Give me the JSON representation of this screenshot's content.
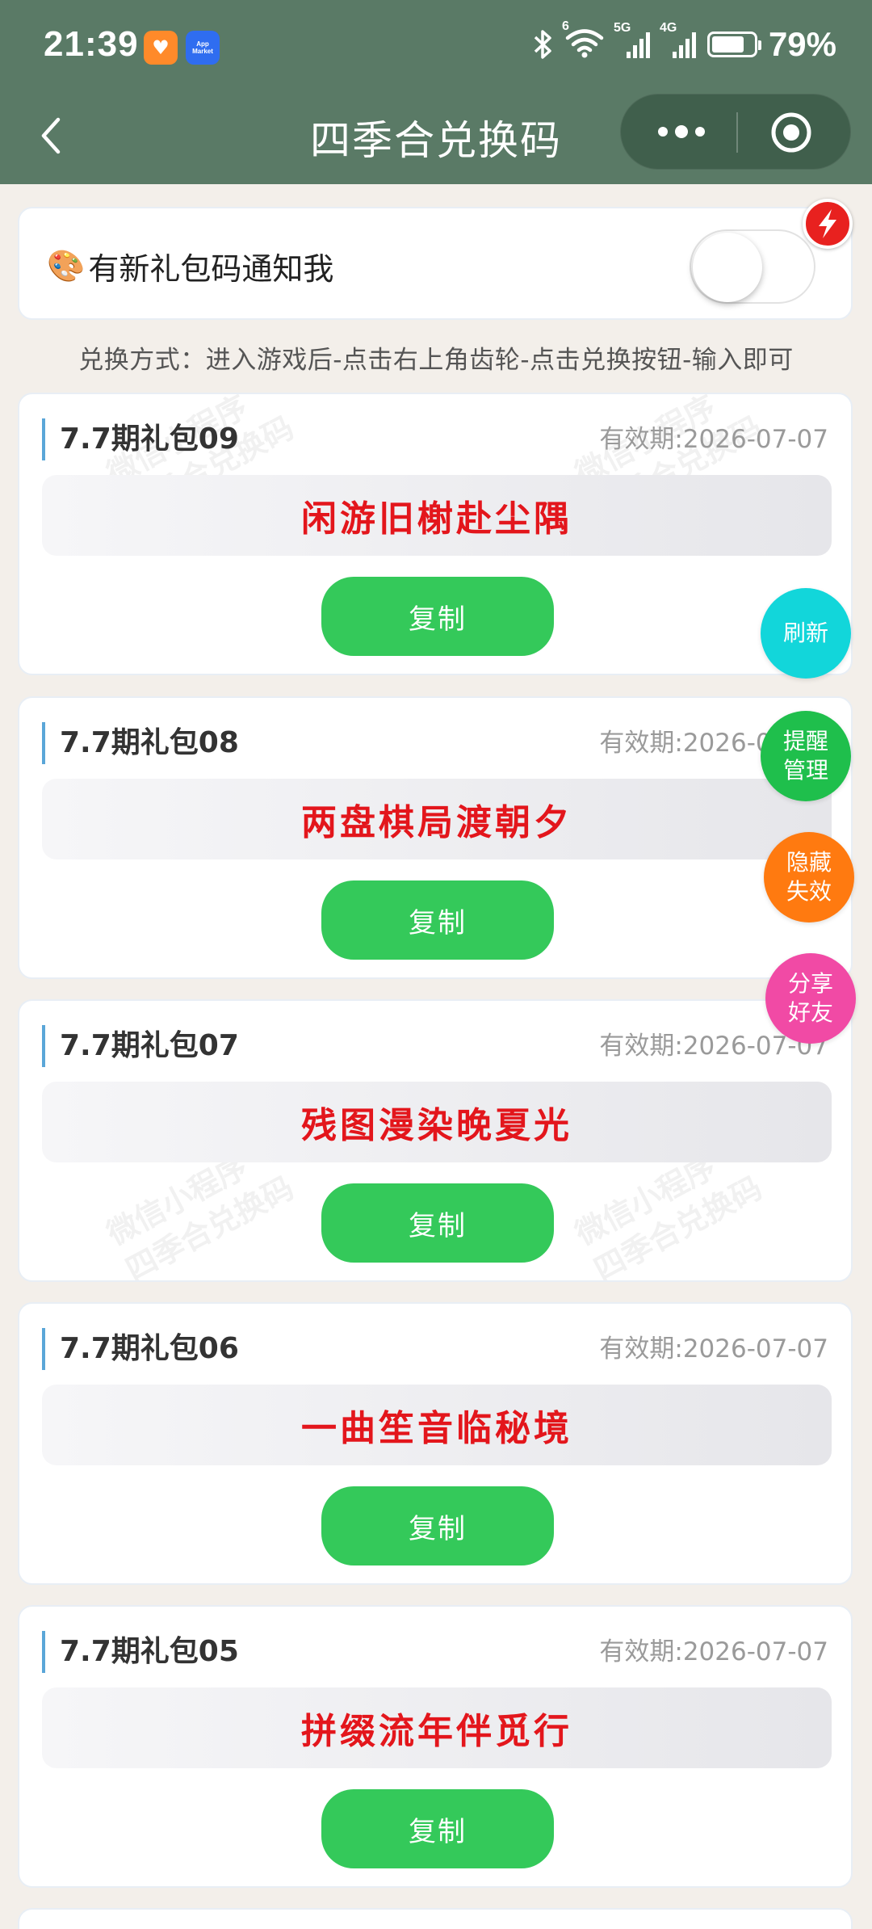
{
  "status_bar": {
    "time": "21:39",
    "network_wifi_badge": "6",
    "network_5g": "5G",
    "network_4g": "4G",
    "battery_percent": "79%",
    "battery_level": 0.79,
    "app_icon_blue_text": "App Market"
  },
  "navbar": {
    "title": "四季合兑换码"
  },
  "notify": {
    "label": "有新礼包码通知我",
    "enabled": false
  },
  "howto": "兑换方式：进入游戏后-点击右上角齿轮-点击兑换按钮-输入即可",
  "cards": [
    {
      "title": "7.7期礼包09",
      "expiry": "有效期:2026-07-07",
      "code": "闲游旧榭赴尘隅",
      "copy_label": "复制"
    },
    {
      "title": "7.7期礼包08",
      "expiry": "有效期:2026-07-07",
      "code": "两盘棋局渡朝夕",
      "copy_label": "复制"
    },
    {
      "title": "7.7期礼包07",
      "expiry": "有效期:2026-07-07",
      "code": "残图漫染晚夏光",
      "copy_label": "复制"
    },
    {
      "title": "7.7期礼包06",
      "expiry": "有效期:2026-07-07",
      "code": "一曲笙音临秘境",
      "copy_label": "复制"
    },
    {
      "title": "7.7期礼包05",
      "expiry": "有效期:2026-07-07",
      "code": "拼缀流年伴觅行",
      "copy_label": "复制"
    }
  ],
  "watermark": {
    "line1": "微信小程序",
    "line2": "四季合兑换码"
  },
  "fabs": {
    "refresh": "刷新",
    "remind_line1": "提醒",
    "remind_line2": "管理",
    "hide_line1": "隐藏",
    "hide_line2": "失效",
    "share_line1": "分享",
    "share_line2": "好友"
  },
  "colors": {
    "header_bg": "#5a7a66",
    "page_bg": "#f3efea",
    "code_red": "#e3161c",
    "copy_green": "#34c95a",
    "refresh_cyan": "#12d6da",
    "remind_green": "#1fbf4c",
    "hide_orange": "#ff7a10",
    "share_pink": "#f14aa5",
    "flash_red": "#e8211f"
  }
}
